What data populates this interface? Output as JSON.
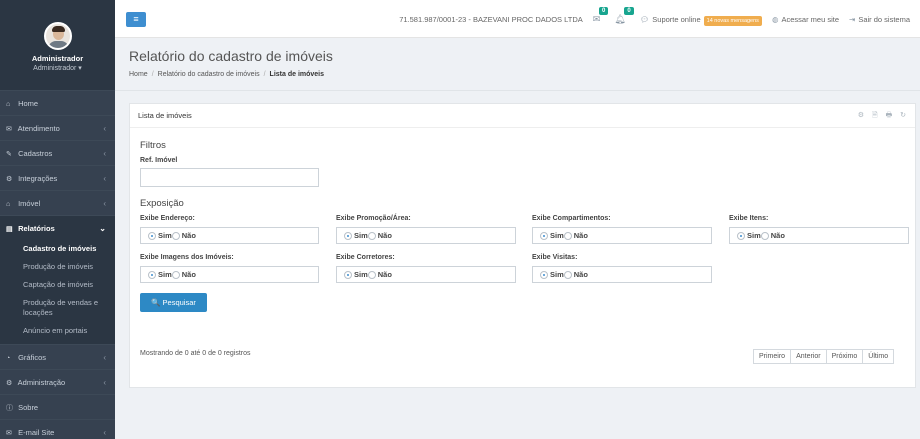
{
  "profile": {
    "name": "Administrador",
    "role": "Administrador ▾"
  },
  "sidebar": {
    "items": [
      {
        "icon": "home-icon",
        "glyph": "⌂",
        "label": "Home",
        "chevron": ""
      },
      {
        "icon": "chat-icon",
        "glyph": "✉",
        "label": "Atendimento",
        "chevron": "‹"
      },
      {
        "icon": "wrench-icon",
        "glyph": "✎",
        "label": "Cadastros",
        "chevron": "‹"
      },
      {
        "icon": "gear-icon",
        "glyph": "⚙",
        "label": "Integrações",
        "chevron": "‹"
      },
      {
        "icon": "home-icon",
        "glyph": "⌂",
        "label": "Imóvel",
        "chevron": "‹"
      },
      {
        "icon": "book-icon",
        "glyph": "▤",
        "label": "Relatórios",
        "chevron": "⌄"
      }
    ],
    "subitems": [
      "Cadastro de imóveis",
      "Produção de imóveis",
      "Captação de imóveis",
      "Produção de vendas e locações",
      "Anúncio em portais"
    ],
    "items_after": [
      {
        "icon": "chart-icon",
        "glyph": "◔",
        "label": "Gráficos",
        "chevron": "‹"
      },
      {
        "icon": "gear-icon",
        "glyph": "⚙",
        "label": "Administração",
        "chevron": "‹"
      },
      {
        "icon": "info-icon",
        "glyph": "ⓘ",
        "label": "Sobre",
        "chevron": ""
      },
      {
        "icon": "envelope-icon",
        "glyph": "✉",
        "label": "E-mail Site",
        "chevron": "‹"
      }
    ]
  },
  "topbar": {
    "menu_glyph": "≡",
    "company": "71.581.987/0001-23 - BAZEVANI PROC DADOS LTDA",
    "mail_badge": "0",
    "bell_badge": "0",
    "support_label": "Suporte online",
    "support_badge": "14 novas mensagens",
    "site_link": "Acessar meu site",
    "logout_link": "Sair do sistema"
  },
  "page": {
    "title": "Relatório do cadastro de imóveis",
    "breadcrumb": [
      "Home",
      "Relatório do cadastro de imóveis",
      "Lista de imóveis"
    ]
  },
  "portlet": {
    "title": "Lista de imóveis",
    "tools": "⚙ 🗎 🖶 ↻"
  },
  "filters": {
    "title": "Filtros",
    "ref_label": "Ref. Imóvel",
    "ref_value": "",
    "exposure_title": "Exposição",
    "options": [
      {
        "label": "Exibe Endereço:",
        "selected": "Sim"
      },
      {
        "label": "Exibe Promoção/Área:",
        "selected": "Sim"
      },
      {
        "label": "Exibe Compartimentos:",
        "selected": "Sim"
      },
      {
        "label": "Exibe Itens:",
        "selected": "Sim"
      },
      {
        "label": "Exibe Imagens dos Imóveis:",
        "selected": "Sim"
      },
      {
        "label": "Exibe Corretores:",
        "selected": "Sim"
      },
      {
        "label": "Exibe Visitas:",
        "selected": "Sim"
      }
    ],
    "yes_label": "Sim",
    "no_label": "Não",
    "search_button": "Pesquisar",
    "search_glyph": "🔍"
  },
  "results": {
    "info": "Mostrando de 0 até 0 de 0 registros",
    "pager": [
      "Primeiro",
      "Anterior",
      "Próximo",
      "Último"
    ]
  }
}
